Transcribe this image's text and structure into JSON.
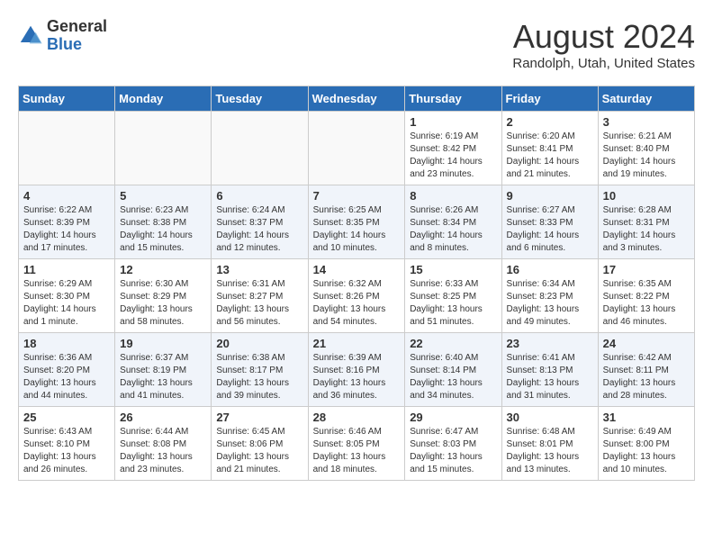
{
  "header": {
    "logo": {
      "general": "General",
      "blue": "Blue"
    },
    "title": "August 2024",
    "location": "Randolph, Utah, United States"
  },
  "weekdays": [
    "Sunday",
    "Monday",
    "Tuesday",
    "Wednesday",
    "Thursday",
    "Friday",
    "Saturday"
  ],
  "weeks": [
    [
      {
        "day": "",
        "info": ""
      },
      {
        "day": "",
        "info": ""
      },
      {
        "day": "",
        "info": ""
      },
      {
        "day": "",
        "info": ""
      },
      {
        "day": "1",
        "info": "Sunrise: 6:19 AM\nSunset: 8:42 PM\nDaylight: 14 hours and 23 minutes."
      },
      {
        "day": "2",
        "info": "Sunrise: 6:20 AM\nSunset: 8:41 PM\nDaylight: 14 hours and 21 minutes."
      },
      {
        "day": "3",
        "info": "Sunrise: 6:21 AM\nSunset: 8:40 PM\nDaylight: 14 hours and 19 minutes."
      }
    ],
    [
      {
        "day": "4",
        "info": "Sunrise: 6:22 AM\nSunset: 8:39 PM\nDaylight: 14 hours and 17 minutes."
      },
      {
        "day": "5",
        "info": "Sunrise: 6:23 AM\nSunset: 8:38 PM\nDaylight: 14 hours and 15 minutes."
      },
      {
        "day": "6",
        "info": "Sunrise: 6:24 AM\nSunset: 8:37 PM\nDaylight: 14 hours and 12 minutes."
      },
      {
        "day": "7",
        "info": "Sunrise: 6:25 AM\nSunset: 8:35 PM\nDaylight: 14 hours and 10 minutes."
      },
      {
        "day": "8",
        "info": "Sunrise: 6:26 AM\nSunset: 8:34 PM\nDaylight: 14 hours and 8 minutes."
      },
      {
        "day": "9",
        "info": "Sunrise: 6:27 AM\nSunset: 8:33 PM\nDaylight: 14 hours and 6 minutes."
      },
      {
        "day": "10",
        "info": "Sunrise: 6:28 AM\nSunset: 8:31 PM\nDaylight: 14 hours and 3 minutes."
      }
    ],
    [
      {
        "day": "11",
        "info": "Sunrise: 6:29 AM\nSunset: 8:30 PM\nDaylight: 14 hours and 1 minute."
      },
      {
        "day": "12",
        "info": "Sunrise: 6:30 AM\nSunset: 8:29 PM\nDaylight: 13 hours and 58 minutes."
      },
      {
        "day": "13",
        "info": "Sunrise: 6:31 AM\nSunset: 8:27 PM\nDaylight: 13 hours and 56 minutes."
      },
      {
        "day": "14",
        "info": "Sunrise: 6:32 AM\nSunset: 8:26 PM\nDaylight: 13 hours and 54 minutes."
      },
      {
        "day": "15",
        "info": "Sunrise: 6:33 AM\nSunset: 8:25 PM\nDaylight: 13 hours and 51 minutes."
      },
      {
        "day": "16",
        "info": "Sunrise: 6:34 AM\nSunset: 8:23 PM\nDaylight: 13 hours and 49 minutes."
      },
      {
        "day": "17",
        "info": "Sunrise: 6:35 AM\nSunset: 8:22 PM\nDaylight: 13 hours and 46 minutes."
      }
    ],
    [
      {
        "day": "18",
        "info": "Sunrise: 6:36 AM\nSunset: 8:20 PM\nDaylight: 13 hours and 44 minutes."
      },
      {
        "day": "19",
        "info": "Sunrise: 6:37 AM\nSunset: 8:19 PM\nDaylight: 13 hours and 41 minutes."
      },
      {
        "day": "20",
        "info": "Sunrise: 6:38 AM\nSunset: 8:17 PM\nDaylight: 13 hours and 39 minutes."
      },
      {
        "day": "21",
        "info": "Sunrise: 6:39 AM\nSunset: 8:16 PM\nDaylight: 13 hours and 36 minutes."
      },
      {
        "day": "22",
        "info": "Sunrise: 6:40 AM\nSunset: 8:14 PM\nDaylight: 13 hours and 34 minutes."
      },
      {
        "day": "23",
        "info": "Sunrise: 6:41 AM\nSunset: 8:13 PM\nDaylight: 13 hours and 31 minutes."
      },
      {
        "day": "24",
        "info": "Sunrise: 6:42 AM\nSunset: 8:11 PM\nDaylight: 13 hours and 28 minutes."
      }
    ],
    [
      {
        "day": "25",
        "info": "Sunrise: 6:43 AM\nSunset: 8:10 PM\nDaylight: 13 hours and 26 minutes."
      },
      {
        "day": "26",
        "info": "Sunrise: 6:44 AM\nSunset: 8:08 PM\nDaylight: 13 hours and 23 minutes."
      },
      {
        "day": "27",
        "info": "Sunrise: 6:45 AM\nSunset: 8:06 PM\nDaylight: 13 hours and 21 minutes."
      },
      {
        "day": "28",
        "info": "Sunrise: 6:46 AM\nSunset: 8:05 PM\nDaylight: 13 hours and 18 minutes."
      },
      {
        "day": "29",
        "info": "Sunrise: 6:47 AM\nSunset: 8:03 PM\nDaylight: 13 hours and 15 minutes."
      },
      {
        "day": "30",
        "info": "Sunrise: 6:48 AM\nSunset: 8:01 PM\nDaylight: 13 hours and 13 minutes."
      },
      {
        "day": "31",
        "info": "Sunrise: 6:49 AM\nSunset: 8:00 PM\nDaylight: 13 hours and 10 minutes."
      }
    ]
  ]
}
